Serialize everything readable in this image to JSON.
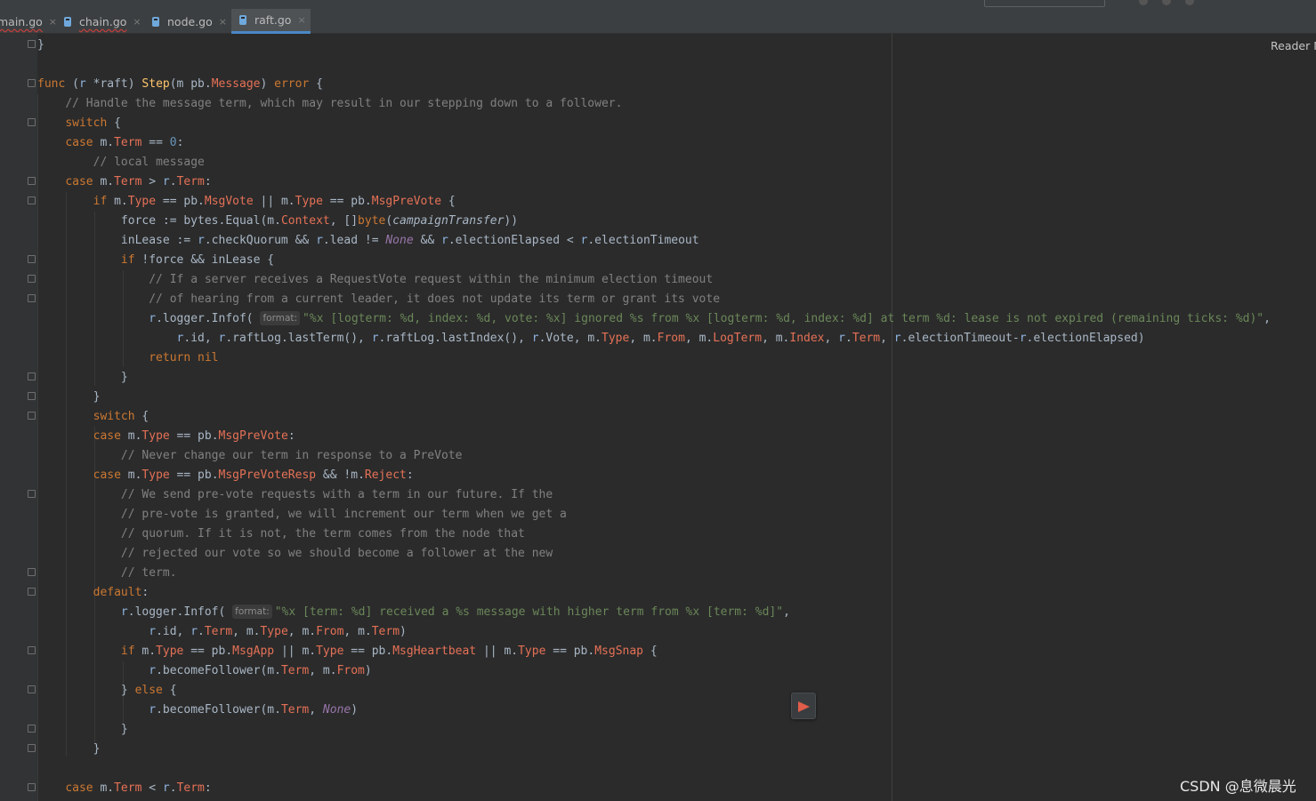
{
  "tabs": [
    {
      "label": "main.go",
      "error": true,
      "active": false
    },
    {
      "label": "chain.go",
      "error": true,
      "active": false
    },
    {
      "label": "node.go",
      "error": false,
      "active": false
    },
    {
      "label": "raft.go",
      "error": false,
      "active": true
    }
  ],
  "close_glyph": "×",
  "reader_mode_label": "Reader M",
  "watermark": "CSDN @息微晨光",
  "param_hint": "format:",
  "colors": {
    "background": "#2b2b2b",
    "keyword": "#cc7832",
    "function": "#ffc66d",
    "string": "#6a8759",
    "comment": "#808080",
    "number": "#6897bb",
    "active_tab_underline": "#4a88c7"
  },
  "icons": [
    "go-file-icon",
    "close-icon",
    "fold-marker-icon",
    "play-arrow-icon"
  ],
  "code": [
    "}",
    "",
    "func (r *raft) Step(m pb.Message) error {",
    "    // Handle the message term, which may result in our stepping down to a follower.",
    "    switch {",
    "    case m.Term == 0:",
    "        // local message",
    "    case m.Term > r.Term:",
    "        if m.Type == pb.MsgVote || m.Type == pb.MsgPreVote {",
    "            force := bytes.Equal(m.Context, []byte(campaignTransfer))",
    "            inLease := r.checkQuorum && r.lead != None && r.electionElapsed < r.electionTimeout",
    "            if !force && inLease {",
    "                // If a server receives a RequestVote request within the minimum election timeout",
    "                // of hearing from a current leader, it does not update its term or grant its vote",
    "                r.logger.Infof( format: \"%x [logterm: %d, index: %d, vote: %x] ignored %s from %x [logterm: %d, index: %d] at term %d: lease is not expired (remaining ticks: %d)\",",
    "                    r.id, r.raftLog.lastTerm(), r.raftLog.lastIndex(), r.Vote, m.Type, m.From, m.LogTerm, m.Index, r.Term, r.electionTimeout-r.electionElapsed)",
    "                return nil",
    "            }",
    "        }",
    "        switch {",
    "        case m.Type == pb.MsgPreVote:",
    "            // Never change our term in response to a PreVote",
    "        case m.Type == pb.MsgPreVoteResp && !m.Reject:",
    "            // We send pre-vote requests with a term in our future. If the",
    "            // pre-vote is granted, we will increment our term when we get a",
    "            // quorum. If it is not, the term comes from the node that",
    "            // rejected our vote so we should become a follower at the new",
    "            // term.",
    "        default:",
    "            r.logger.Infof( format: \"%x [term: %d] received a %s message with higher term from %x [term: %d]\",",
    "                r.id, r.Term, m.Type, m.From, m.Term)",
    "            if m.Type == pb.MsgApp || m.Type == pb.MsgHeartbeat || m.Type == pb.MsgSnap {",
    "                r.becomeFollower(m.Term, m.From)",
    "            } else {",
    "                r.becomeFollower(m.Term, None)",
    "            }",
    "        }",
    "",
    "    case m.Term < r.Term:"
  ]
}
